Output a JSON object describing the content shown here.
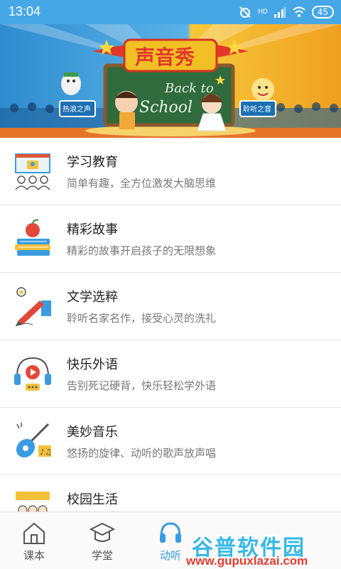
{
  "status_bar": {
    "time": "13:04",
    "battery": "45",
    "network_label": "HD",
    "icons": [
      "alarm-off-icon",
      "signal-icon",
      "wifi-icon",
      "battery-icon"
    ]
  },
  "banner": {
    "headline": "声音秀",
    "board_text_1": "Back to",
    "board_text_2": "School",
    "left_sign": "热浪之声",
    "right_sign": "聆听之音"
  },
  "categories": [
    {
      "title": "学习教育",
      "subtitle": "简单有趣，全方位激发大脑思维",
      "icon": "classroom-icon"
    },
    {
      "title": "精彩故事",
      "subtitle": "精彩的故事开启孩子的无限想象",
      "icon": "books-apple-icon"
    },
    {
      "title": "文学选粹",
      "subtitle": "聆听名家名作，接受心灵的洗礼",
      "icon": "pen-writing-icon"
    },
    {
      "title": "快乐外语",
      "subtitle": "告别死记硬背，快乐轻松学外语",
      "icon": "headphones-play-icon"
    },
    {
      "title": "美妙音乐",
      "subtitle": "悠扬的旋律、动听的歌声放声唱",
      "icon": "guitar-music-icon"
    },
    {
      "title": "校园生活",
      "subtitle": "",
      "icon": "campus-kids-icon"
    }
  ],
  "tabbar": {
    "tabs": [
      {
        "label": "课本",
        "icon": "home-icon"
      },
      {
        "label": "学堂",
        "icon": "graduation-cap-icon"
      },
      {
        "label": "动听",
        "icon": "headphones-icon",
        "active": true
      }
    ]
  },
  "watermark": {
    "name": "谷普软件园",
    "url": "www.gupuxlazai.com"
  },
  "colors": {
    "accent": "#3a9be0",
    "status_bar": "#46a7e6",
    "divider": "#e5e5e5"
  }
}
